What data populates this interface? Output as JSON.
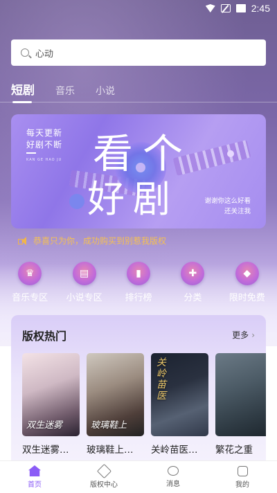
{
  "status_bar": {
    "time": "2:45"
  },
  "search": {
    "placeholder": "心动"
  },
  "tabs": [
    {
      "label": "短剧",
      "active": true
    },
    {
      "label": "音乐",
      "active": false
    },
    {
      "label": "小说",
      "active": false
    }
  ],
  "banner": {
    "left_line1": "每天更新",
    "left_line2": "好剧不断",
    "left_small": "KAN GE HAO JU",
    "big_line1": "看个",
    "big_line2": "好剧",
    "right_line1": "谢谢你这么好看",
    "right_line2": "还关注我"
  },
  "notice": {
    "text": "恭喜只为你，成功购买到别惹我版权"
  },
  "categories": [
    {
      "label": "音乐专区",
      "icon": "crown-icon"
    },
    {
      "label": "小说专区",
      "icon": "book-icon"
    },
    {
      "label": "排行榜",
      "icon": "bar-chart-icon"
    },
    {
      "label": "分类",
      "icon": "grid-icon"
    },
    {
      "label": "限时免费",
      "icon": "tag-icon"
    }
  ],
  "hot_panel": {
    "title": "版权热门",
    "more": "更多",
    "books": [
      {
        "title": "双生迷雾…",
        "cover_text": "双生迷雾"
      },
      {
        "title": "玻璃鞋上…",
        "cover_text": "玻璃鞋上"
      },
      {
        "title": "关岭苗医…",
        "cover_text": "关岭苗医"
      },
      {
        "title": "繁花之重",
        "cover_text": ""
      }
    ]
  },
  "bottom_nav": [
    {
      "label": "首页",
      "active": true
    },
    {
      "label": "版权中心",
      "active": false
    },
    {
      "label": "消息",
      "active": false
    },
    {
      "label": "我的",
      "active": false
    }
  ],
  "colors": {
    "accent": "#8b5cf6",
    "notice": "#f5c052"
  }
}
